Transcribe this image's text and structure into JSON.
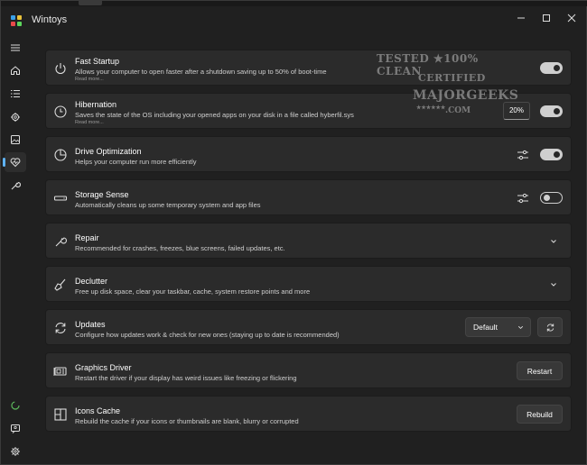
{
  "window": {
    "title": "Wintoys"
  },
  "titlebar": {
    "minimize_icon": "minimize-icon",
    "maximize_icon": "maximize-icon",
    "close_icon": "close-icon"
  },
  "sidebar": {
    "items": [
      {
        "icon": "hamburger-menu-icon"
      },
      {
        "icon": "home-icon"
      },
      {
        "icon": "apps-list-icon"
      },
      {
        "icon": "services-gear-icon"
      },
      {
        "icon": "tweaks-image-icon"
      },
      {
        "icon": "health-heart-icon",
        "active": true
      },
      {
        "icon": "tools-wrench-icon"
      }
    ],
    "bottom": [
      {
        "icon": "loading-circle-icon"
      },
      {
        "icon": "feedback-person-icon"
      },
      {
        "icon": "settings-gear-icon"
      }
    ]
  },
  "watermark": {
    "line1": "TESTED ★100% CLEAN",
    "line2": "CERTIFIED",
    "line3": "MAJORGEEKS",
    "line4": ".COM",
    "stars": "★★★★★★"
  },
  "cards": {
    "fast_startup": {
      "title": "Fast Startup",
      "desc": "Allows your computer to open faster after a shutdown saving up to 50% of boot-time",
      "more": "Read more...",
      "icon": "power-icon",
      "toggle_on": true
    },
    "hibernation": {
      "title": "Hibernation",
      "desc": "Saves the state of the OS including your opened apps on your disk in a file called hyberfil.sys",
      "more": "Read more...",
      "icon": "clock-icon",
      "percent": "20%",
      "toggle_on": true
    },
    "drive_opt": {
      "title": "Drive Optimization",
      "desc": "Helps your computer run more efficiently",
      "icon": "pie-chart-icon",
      "toggle_on": true
    },
    "storage_sense": {
      "title": "Storage Sense",
      "desc": "Automatically cleans up some temporary system and app files",
      "icon": "drive-icon",
      "toggle_on": false
    },
    "repair": {
      "title": "Repair",
      "desc": "Recommended for crashes, freezes, blue screens, failed updates, etc.",
      "icon": "wrench-icon"
    },
    "declutter": {
      "title": "Declutter",
      "desc": "Free up disk space, clear your taskbar, cache, system restore points and more",
      "icon": "broom-icon"
    },
    "updates": {
      "title": "Updates",
      "desc": "Configure how updates work & check for new ones (staying up to date is recommended)",
      "icon": "sync-icon",
      "select_value": "Default"
    },
    "graphics": {
      "title": "Graphics Driver",
      "desc": "Restart the driver if your display has weird issues like freezing or flickering",
      "icon": "gpu-icon",
      "button": "Restart"
    },
    "icons_cache": {
      "title": "Icons Cache",
      "desc": "Rebuild the cache if your icons or thumbnails are blank, blurry or corrupted",
      "icon": "grid-icon",
      "button": "Rebuild"
    }
  }
}
